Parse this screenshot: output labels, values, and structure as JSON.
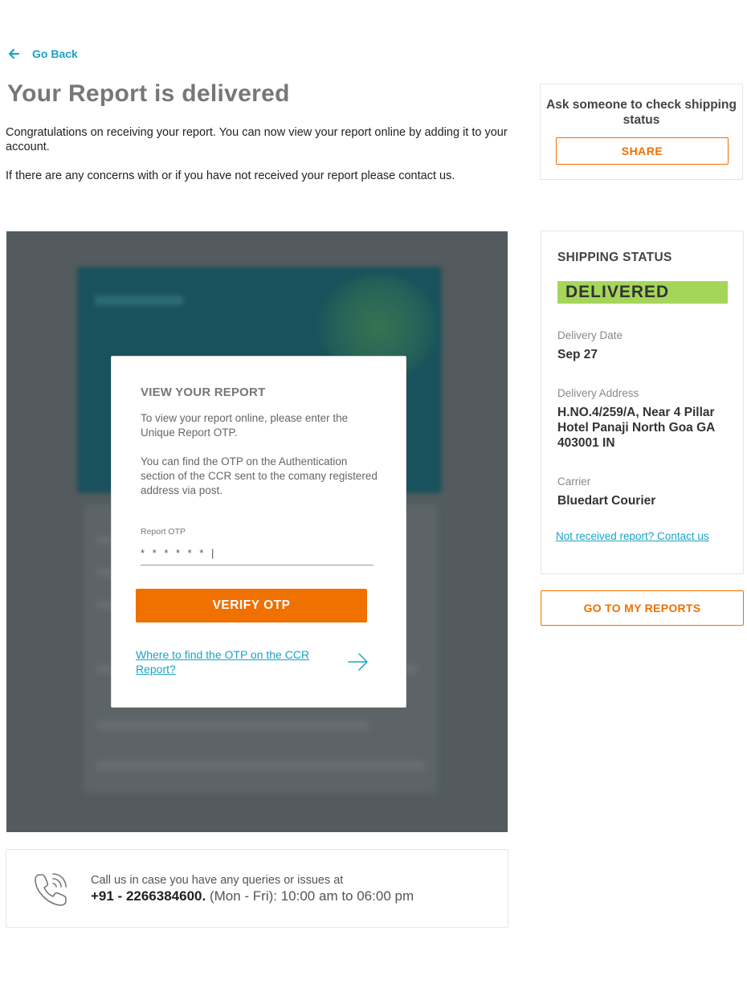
{
  "nav": {
    "back_label": "Go Back"
  },
  "page": {
    "title": "Your Report is delivered",
    "intro_1": "Congratulations on receiving your report. You can now view your report online by adding it to your account.",
    "intro_2": "If there are any concerns with or if you have not received your report please contact us."
  },
  "share_card": {
    "question": "Ask someone to check shipping status",
    "share_label": "SHARE"
  },
  "otp_card": {
    "heading": "VIEW YOUR REPORT",
    "para_1": "To view your report online, please enter the Unique Report OTP.",
    "para_2": "You can find the OTP on the Authentication section of the CCR sent to the comany registered address via post.",
    "field_label": "Report OTP",
    "field_value": "* * * * * * |",
    "verify_label": "VERIFY OTP",
    "help_link": "Where to find the OTP on the CCR Report?"
  },
  "shipping": {
    "heading": "SHIPPING STATUS",
    "status": "DELIVERED",
    "status_color": "#a5d65a",
    "date_label": "Delivery Date",
    "date_value": "Sep 27",
    "address_label": "Delivery Address",
    "address_value": "H.NO.4/259/A, Near 4 Pillar Hotel Panaji North Goa GA 403001 IN",
    "carrier_label": "Carrier",
    "carrier_value": "Bluedart Courier",
    "contact_link": "Not received report? Contact us"
  },
  "my_reports_label": "GO TO MY REPORTS",
  "contact": {
    "lead": "Call us in case you have any queries or issues at",
    "phone": "+91 - 2266384600.",
    "hours": "(Mon - Fri): 10:00 am to 06:00 pm"
  },
  "theme": {
    "accent": "#f07000",
    "link": "#1aa3c8"
  },
  "icons": {
    "back": "arrow-left-icon",
    "help": "arrow-right-icon",
    "phone": "phone-icon"
  }
}
